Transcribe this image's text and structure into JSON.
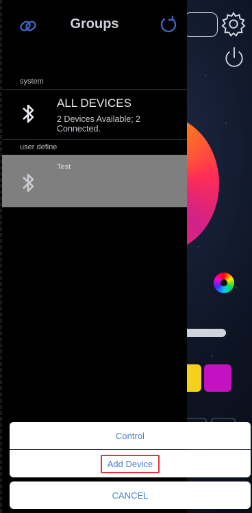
{
  "drawer": {
    "title": "Groups",
    "sections": {
      "system_label": "system",
      "user_label": "user define"
    },
    "system_group": {
      "title": "ALL DEVICES",
      "subtitle": "2 Devices Available; 2 Connected."
    },
    "user_group": {
      "title": "Test"
    }
  },
  "sheet": {
    "control_label": "Control",
    "add_device_label": "Add Device",
    "cancel_label": "CANCEL"
  },
  "icons": {
    "header_left": "link-icon",
    "header_right": "refresh-icon",
    "row": "bluetooth-icon",
    "settings": "gear-icon",
    "power": "power-icon"
  },
  "colors": {
    "accent": "#4a7fd2",
    "highlight": "#e0343b",
    "selected_row": "#7f7f7f"
  }
}
